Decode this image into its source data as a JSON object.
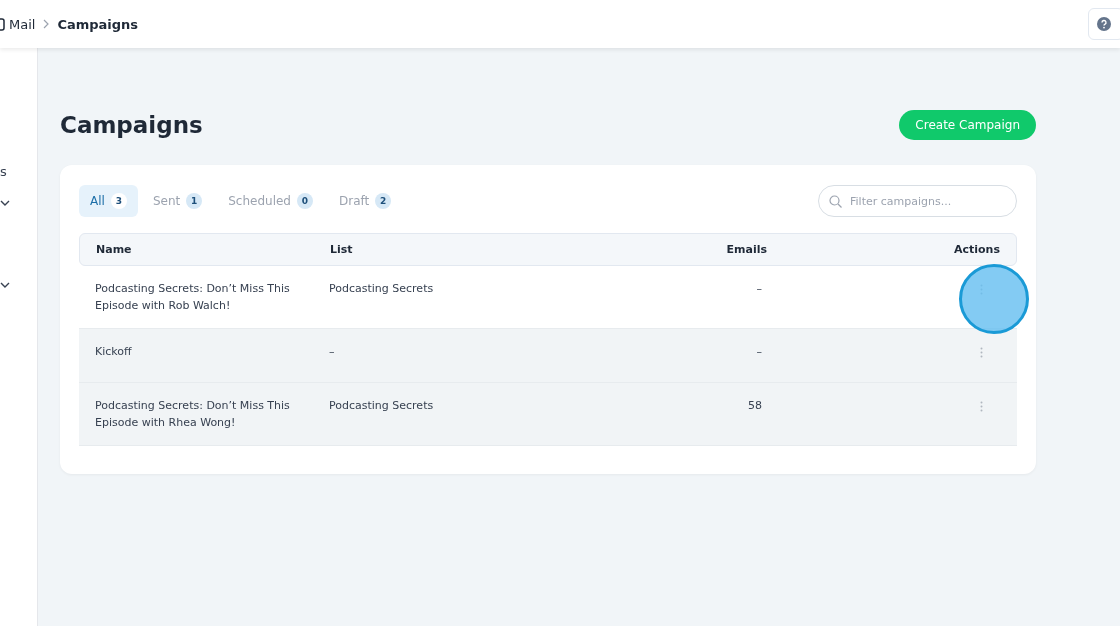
{
  "breadcrumb": {
    "items": [
      "Mail",
      "Campaigns"
    ]
  },
  "sidebar": {
    "items": [
      {
        "label": "s",
        "kind": "text"
      },
      {
        "kind": "group",
        "expanded": false
      },
      {
        "kind": "group",
        "expanded": false
      }
    ]
  },
  "page": {
    "title": "Campaigns",
    "primary_button": "Create Campaign"
  },
  "tabs": [
    {
      "label": "All",
      "count": "3",
      "selected": true
    },
    {
      "label": "Sent",
      "count": "1",
      "selected": false
    },
    {
      "label": "Scheduled",
      "count": "0",
      "selected": false
    },
    {
      "label": "Draft",
      "count": "2",
      "selected": false
    }
  ],
  "search": {
    "placeholder": "Filter campaigns..."
  },
  "table": {
    "columns": [
      "Name",
      "List",
      "Emails",
      "Actions"
    ],
    "rows": [
      {
        "name": "Podcasting Secrets: Don’t Miss This Episode with Rob Walch!",
        "list": "Podcasting Secrets",
        "emails": "–",
        "striped": false
      },
      {
        "name": "Kickoff",
        "list": "–",
        "emails": "–",
        "striped": true
      },
      {
        "name": "Podcasting Secrets: Don’t Miss This Episode with Rhea Wong!",
        "list": "Podcasting Secrets",
        "emails": "58",
        "striped": true
      }
    ]
  }
}
